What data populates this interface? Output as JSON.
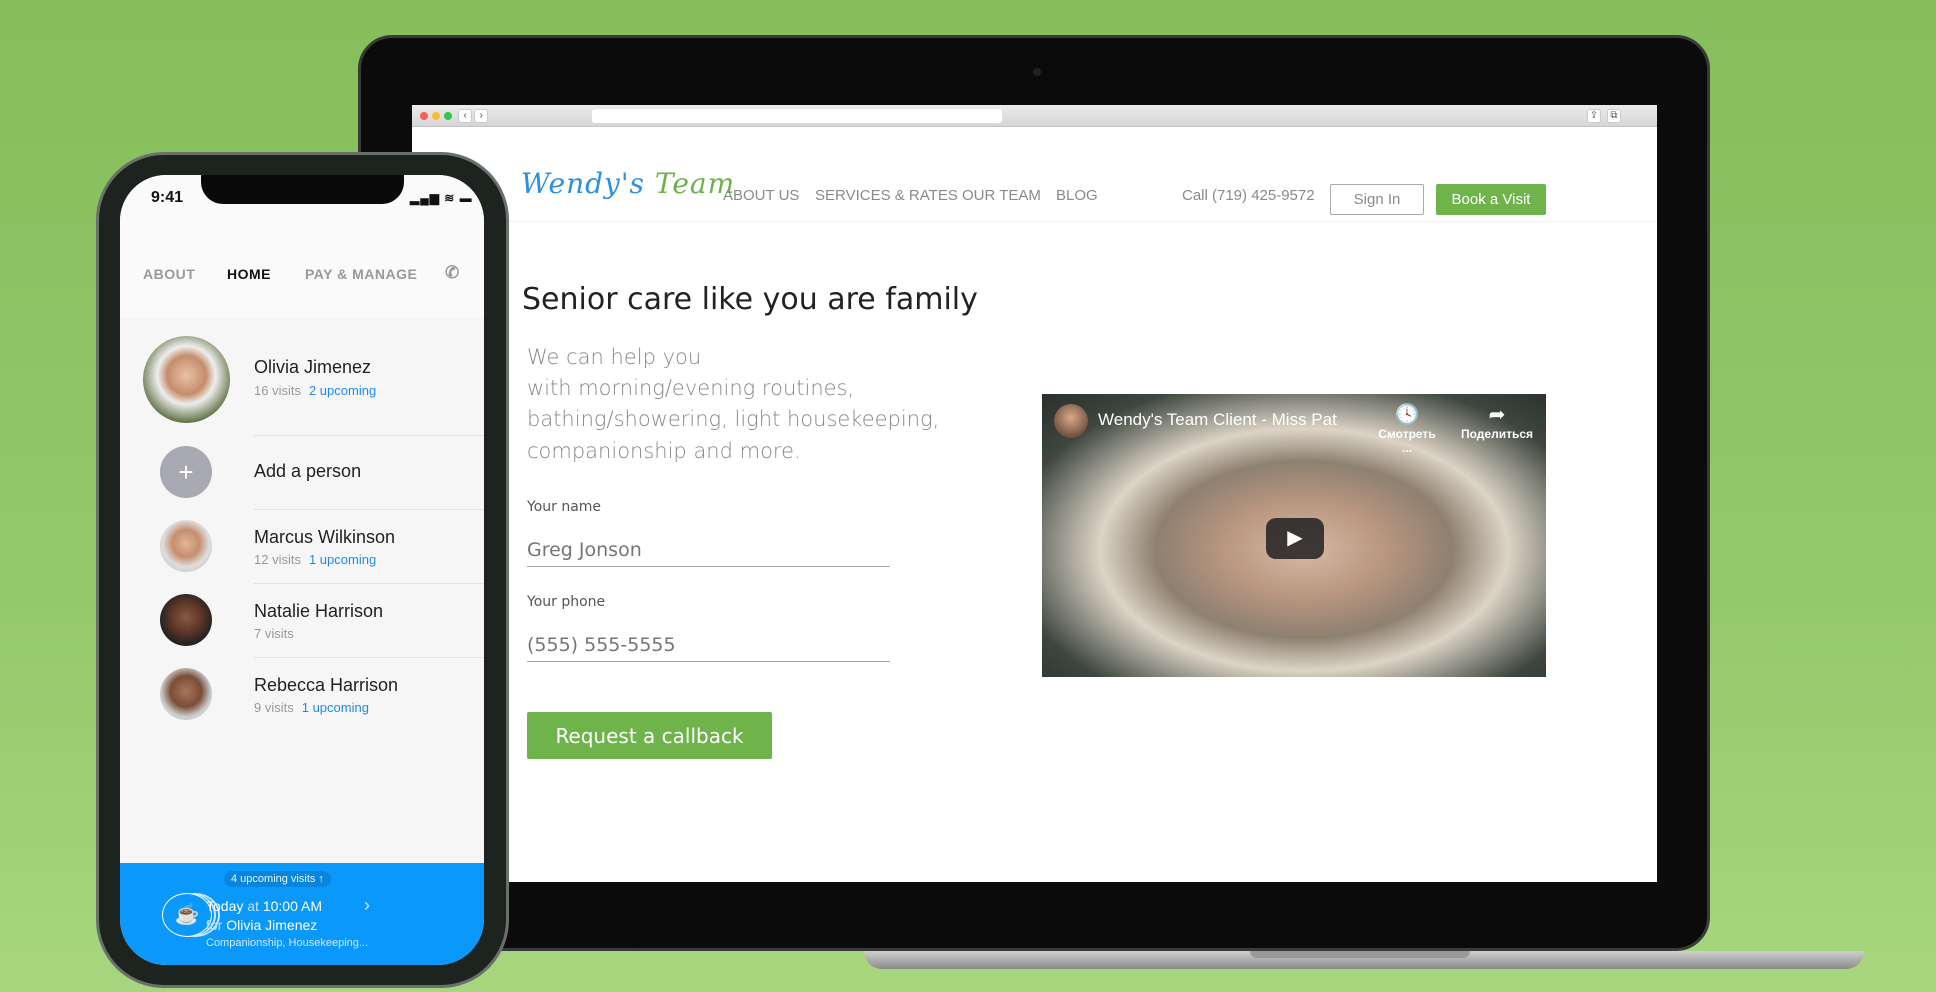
{
  "browser": {
    "back": "‹",
    "forward": "›"
  },
  "site": {
    "logo": {
      "first": "Wendy's",
      "second": "Team"
    },
    "nav": [
      "ABOUT US",
      "SERVICES & RATES",
      "OUR TEAM",
      "BLOG"
    ],
    "call": "Call (719) 425-9572",
    "sign_in": "Sign In",
    "book": "Book a Visit",
    "heading": "Senior care like you are family",
    "paragraph": [
      "We can help you",
      "with morning/evening routines,",
      "bathing/showering, light housekeeping,",
      "companionship and more."
    ],
    "form": {
      "name_label": "Your name",
      "name_placeholder": "Greg Jonson",
      "phone_label": "Your phone",
      "phone_placeholder": "(555) 555-5555",
      "submit": "Request a callback"
    },
    "video": {
      "title": "Wendy's Team Client - Miss Pat",
      "watch_later": "Смотреть ...",
      "share": "Поделиться",
      "play_icon": "▶",
      "clock_icon": "🕓",
      "share_icon": "➦"
    }
  },
  "colors": {
    "brand_green": "#6fb34b",
    "brand_blue": "#2e8fe0",
    "app_blue": "#0a99fa",
    "link_blue": "#1a8cf0"
  },
  "phone": {
    "time": "9:41",
    "status_icons": "▂▄▆ ≋ ▬",
    "tabs": [
      "ABOUT",
      "HOME",
      "PAY & MANAGE"
    ],
    "call_icon": "✆",
    "people": [
      {
        "name": "Olivia Jimenez",
        "visits": "16 visits",
        "upcoming": "2 upcoming"
      },
      {
        "name": "Marcus Wilkinson",
        "visits": "12 visits",
        "upcoming": "1 upcoming"
      },
      {
        "name": "Natalie Harrison",
        "visits": "7 visits",
        "upcoming": ""
      },
      {
        "name": "Rebecca Harrison",
        "visits": "9 visits",
        "upcoming": "1 upcoming"
      }
    ],
    "add_person": "Add a person",
    "add_icon": "+",
    "bar": {
      "badge": "4 upcoming visits ↑",
      "today": "Today",
      "at": "at",
      "time": "10:00 AM",
      "for": "for",
      "person": "Olivia Jimenez",
      "services": "Companionship, Housekeeping...",
      "cup_icon": "☕",
      "chevron": "›"
    }
  }
}
